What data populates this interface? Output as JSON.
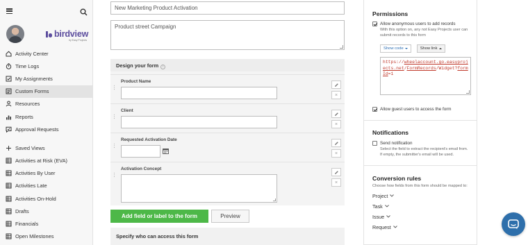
{
  "sidebar": {
    "logo": "birdview",
    "logo_sub": "by Easy Projects",
    "items": [
      {
        "label": "Activity Center",
        "icon": "home-icon"
      },
      {
        "label": "Time Logs",
        "icon": "stopwatch-icon"
      },
      {
        "label": "My Assignments",
        "icon": "checkbox-icon"
      },
      {
        "label": "Custom Forms",
        "icon": "forms-icon",
        "active": true
      },
      {
        "label": "Resources",
        "icon": "user-icon"
      },
      {
        "label": "Reports",
        "icon": "bar-chart-icon"
      },
      {
        "label": "Approval Requests",
        "icon": "approval-icon"
      }
    ],
    "saved_views_label": "Saved Views",
    "views": [
      {
        "label": "Activities at Risk (EVA)"
      },
      {
        "label": "Activities By User"
      },
      {
        "label": "Activities Late"
      },
      {
        "label": "Activities On-Hold"
      },
      {
        "label": "Drafts"
      },
      {
        "label": "Financials"
      },
      {
        "label": "Open Milestones"
      }
    ]
  },
  "form": {
    "title_value": "New Marketing Product Activation",
    "description_value": "Product street Campaign",
    "design_heading": "Design your form",
    "fields": [
      {
        "label": "Product Name",
        "type": "text"
      },
      {
        "label": "Client",
        "type": "text"
      },
      {
        "label": "Requested Activation Date",
        "type": "date"
      },
      {
        "label": "Activation Concept",
        "type": "textarea"
      }
    ],
    "delete_glyph": "×",
    "add_field_label": "Add field or label to the form",
    "preview_label": "Preview",
    "access_heading": "Specify who can access this form"
  },
  "permissions": {
    "title": "Permissions",
    "allow_anonymous_label": "Allow anonymous users to add records",
    "allow_anonymous_checked": true,
    "anonymous_hint": "With this option on, any not Easy Projects user can submit records to this form",
    "show_code_label": "Show code",
    "show_link_label": "Show link",
    "link_text_plain_1": "https://",
    "link_text_u1": "wheelaccount.go.easyprojects.net",
    "link_text_plain_2": "/",
    "link_text_u2": "FormRecords",
    "link_text_plain_3": "/Widget?",
    "link_text_u3": "formId",
    "link_text_plain_4": "=1",
    "allow_guest_label": "Allow guest users to access the form",
    "allow_guest_checked": true
  },
  "notifications": {
    "title": "Notifications",
    "send_label": "Send notification",
    "send_checked": false,
    "hint": "Select the field to extract the recipient's email from. If empty, the submitter's email will be used."
  },
  "conversion": {
    "title": "Conversion rules",
    "hint": "Choose how fields from this form should be mapped to:",
    "items": [
      {
        "label": "Project"
      },
      {
        "label": "Task"
      },
      {
        "label": "Issue"
      },
      {
        "label": "Request"
      }
    ]
  },
  "colors": {
    "accent_green": "#4db848",
    "brand_purple": "#5c4d9e",
    "chat_blue": "#2e6fab",
    "link_red": "#c0392b"
  }
}
